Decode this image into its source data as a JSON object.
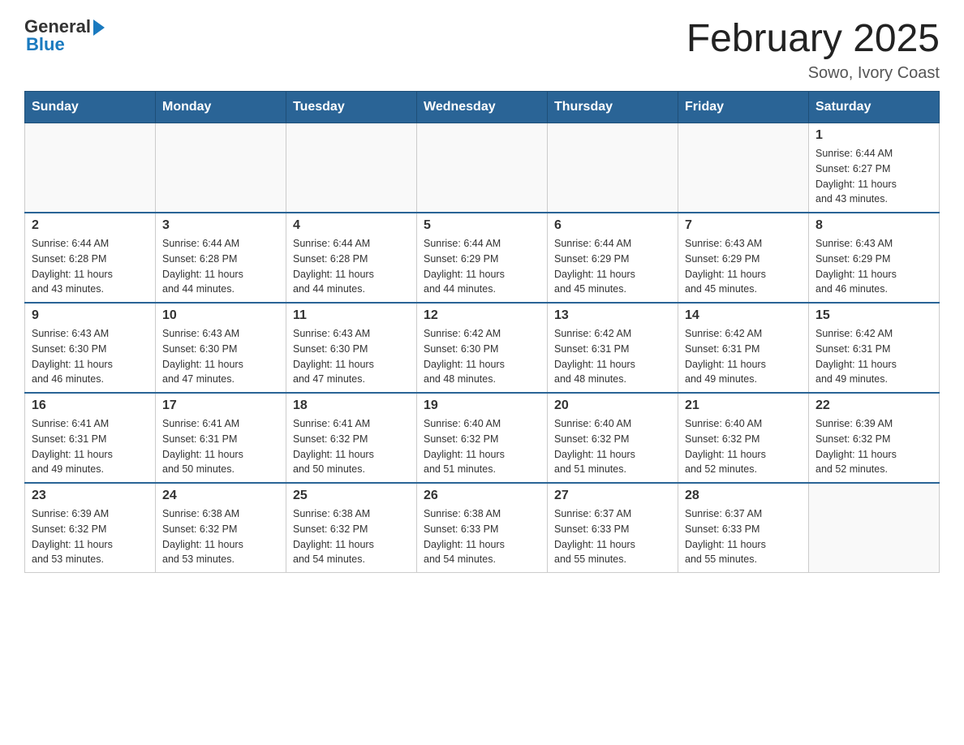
{
  "logo": {
    "general": "General",
    "blue": "Blue"
  },
  "title": "February 2025",
  "location": "Sowo, Ivory Coast",
  "days_of_week": [
    "Sunday",
    "Monday",
    "Tuesday",
    "Wednesday",
    "Thursday",
    "Friday",
    "Saturday"
  ],
  "weeks": [
    [
      {
        "day": "",
        "info": ""
      },
      {
        "day": "",
        "info": ""
      },
      {
        "day": "",
        "info": ""
      },
      {
        "day": "",
        "info": ""
      },
      {
        "day": "",
        "info": ""
      },
      {
        "day": "",
        "info": ""
      },
      {
        "day": "1",
        "info": "Sunrise: 6:44 AM\nSunset: 6:27 PM\nDaylight: 11 hours\nand 43 minutes."
      }
    ],
    [
      {
        "day": "2",
        "info": "Sunrise: 6:44 AM\nSunset: 6:28 PM\nDaylight: 11 hours\nand 43 minutes."
      },
      {
        "day": "3",
        "info": "Sunrise: 6:44 AM\nSunset: 6:28 PM\nDaylight: 11 hours\nand 44 minutes."
      },
      {
        "day": "4",
        "info": "Sunrise: 6:44 AM\nSunset: 6:28 PM\nDaylight: 11 hours\nand 44 minutes."
      },
      {
        "day": "5",
        "info": "Sunrise: 6:44 AM\nSunset: 6:29 PM\nDaylight: 11 hours\nand 44 minutes."
      },
      {
        "day": "6",
        "info": "Sunrise: 6:44 AM\nSunset: 6:29 PM\nDaylight: 11 hours\nand 45 minutes."
      },
      {
        "day": "7",
        "info": "Sunrise: 6:43 AM\nSunset: 6:29 PM\nDaylight: 11 hours\nand 45 minutes."
      },
      {
        "day": "8",
        "info": "Sunrise: 6:43 AM\nSunset: 6:29 PM\nDaylight: 11 hours\nand 46 minutes."
      }
    ],
    [
      {
        "day": "9",
        "info": "Sunrise: 6:43 AM\nSunset: 6:30 PM\nDaylight: 11 hours\nand 46 minutes."
      },
      {
        "day": "10",
        "info": "Sunrise: 6:43 AM\nSunset: 6:30 PM\nDaylight: 11 hours\nand 47 minutes."
      },
      {
        "day": "11",
        "info": "Sunrise: 6:43 AM\nSunset: 6:30 PM\nDaylight: 11 hours\nand 47 minutes."
      },
      {
        "day": "12",
        "info": "Sunrise: 6:42 AM\nSunset: 6:30 PM\nDaylight: 11 hours\nand 48 minutes."
      },
      {
        "day": "13",
        "info": "Sunrise: 6:42 AM\nSunset: 6:31 PM\nDaylight: 11 hours\nand 48 minutes."
      },
      {
        "day": "14",
        "info": "Sunrise: 6:42 AM\nSunset: 6:31 PM\nDaylight: 11 hours\nand 49 minutes."
      },
      {
        "day": "15",
        "info": "Sunrise: 6:42 AM\nSunset: 6:31 PM\nDaylight: 11 hours\nand 49 minutes."
      }
    ],
    [
      {
        "day": "16",
        "info": "Sunrise: 6:41 AM\nSunset: 6:31 PM\nDaylight: 11 hours\nand 49 minutes."
      },
      {
        "day": "17",
        "info": "Sunrise: 6:41 AM\nSunset: 6:31 PM\nDaylight: 11 hours\nand 50 minutes."
      },
      {
        "day": "18",
        "info": "Sunrise: 6:41 AM\nSunset: 6:32 PM\nDaylight: 11 hours\nand 50 minutes."
      },
      {
        "day": "19",
        "info": "Sunrise: 6:40 AM\nSunset: 6:32 PM\nDaylight: 11 hours\nand 51 minutes."
      },
      {
        "day": "20",
        "info": "Sunrise: 6:40 AM\nSunset: 6:32 PM\nDaylight: 11 hours\nand 51 minutes."
      },
      {
        "day": "21",
        "info": "Sunrise: 6:40 AM\nSunset: 6:32 PM\nDaylight: 11 hours\nand 52 minutes."
      },
      {
        "day": "22",
        "info": "Sunrise: 6:39 AM\nSunset: 6:32 PM\nDaylight: 11 hours\nand 52 minutes."
      }
    ],
    [
      {
        "day": "23",
        "info": "Sunrise: 6:39 AM\nSunset: 6:32 PM\nDaylight: 11 hours\nand 53 minutes."
      },
      {
        "day": "24",
        "info": "Sunrise: 6:38 AM\nSunset: 6:32 PM\nDaylight: 11 hours\nand 53 minutes."
      },
      {
        "day": "25",
        "info": "Sunrise: 6:38 AM\nSunset: 6:32 PM\nDaylight: 11 hours\nand 54 minutes."
      },
      {
        "day": "26",
        "info": "Sunrise: 6:38 AM\nSunset: 6:33 PM\nDaylight: 11 hours\nand 54 minutes."
      },
      {
        "day": "27",
        "info": "Sunrise: 6:37 AM\nSunset: 6:33 PM\nDaylight: 11 hours\nand 55 minutes."
      },
      {
        "day": "28",
        "info": "Sunrise: 6:37 AM\nSunset: 6:33 PM\nDaylight: 11 hours\nand 55 minutes."
      },
      {
        "day": "",
        "info": ""
      }
    ]
  ]
}
